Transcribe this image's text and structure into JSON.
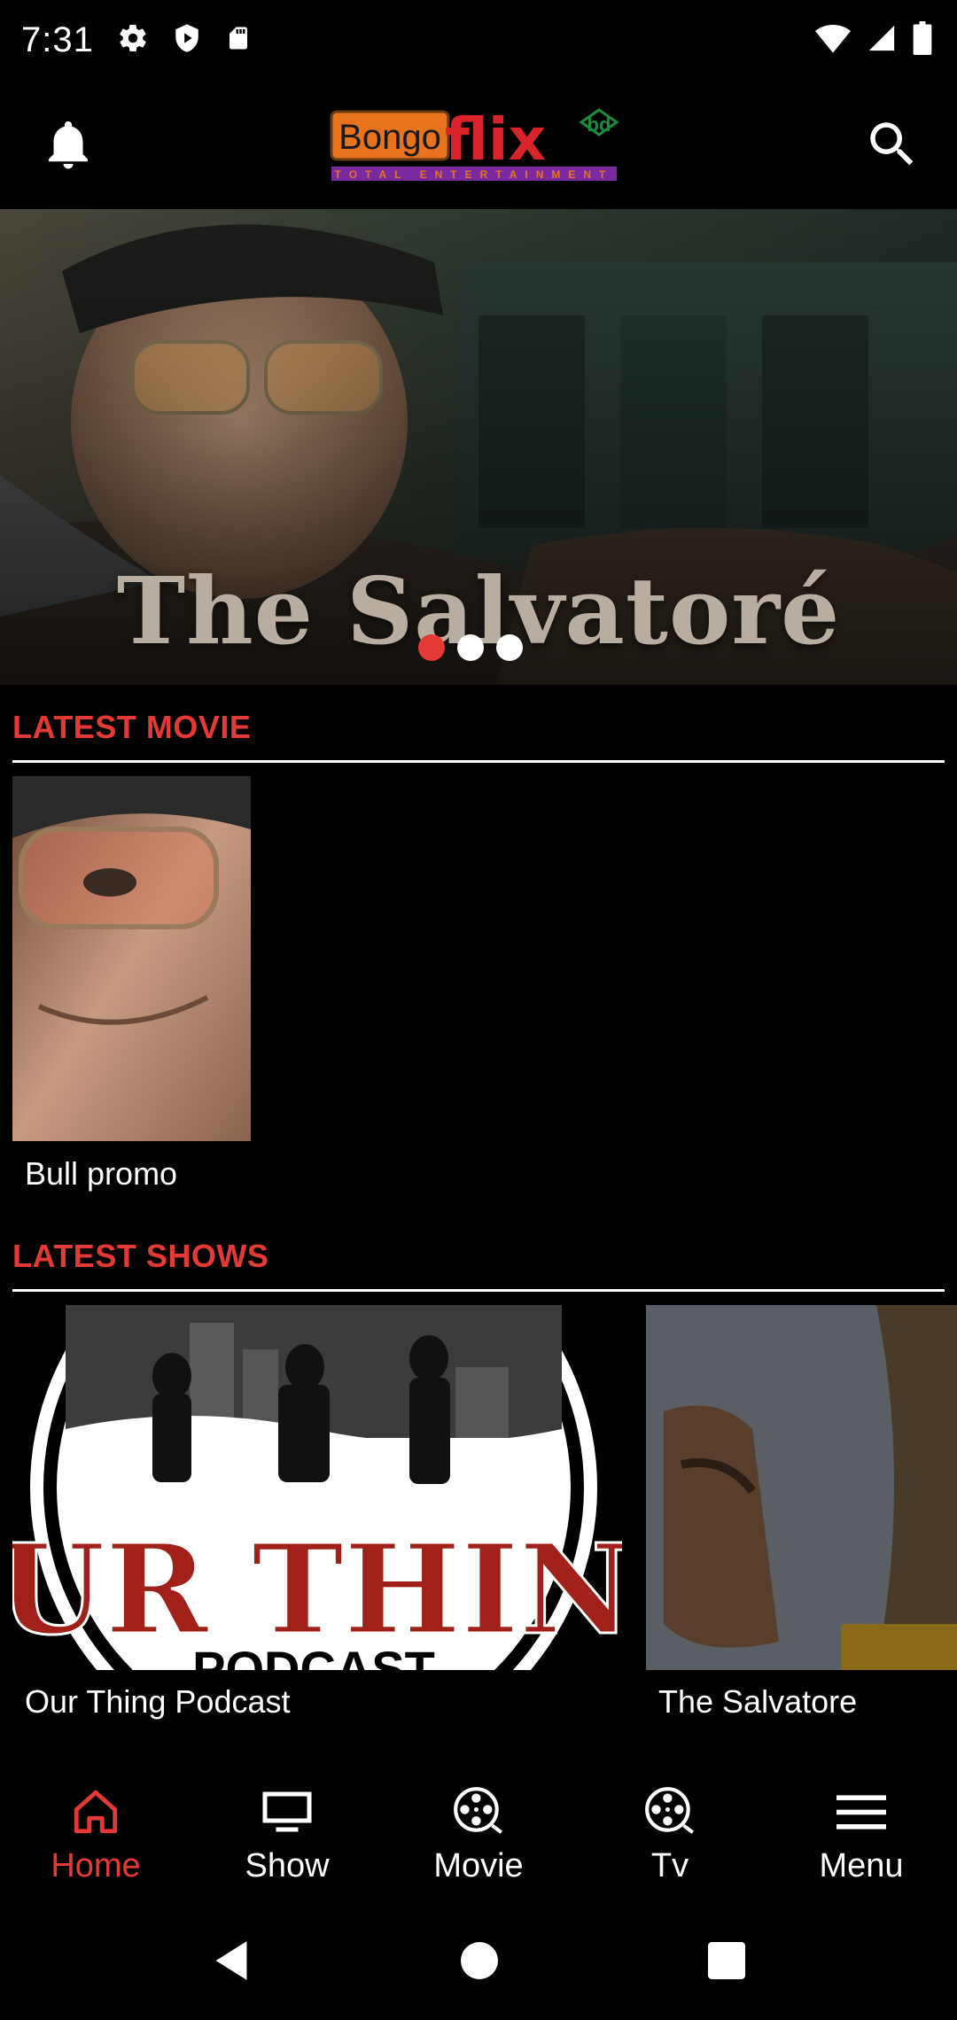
{
  "status_bar": {
    "time": "7:31",
    "icons": [
      "gear-icon",
      "shield-play-icon",
      "sd-card-icon",
      "wifi-icon",
      "signal-icon",
      "battery-icon"
    ]
  },
  "app_bar": {
    "logo_main": "Bongo",
    "logo_flix": "flix",
    "logo_bd": "bd",
    "logo_tagline": "TOTAL ENTERTAINMENT",
    "icons": [
      "bell-icon",
      "search-icon"
    ]
  },
  "hero": {
    "title": "The Salvatoré",
    "slides": 3,
    "active_slide": 1
  },
  "latest_movie": {
    "heading": "LATEST MOVIE",
    "items": [
      {
        "label": "Bull promo"
      }
    ]
  },
  "latest_shows": {
    "heading": "LATEST SHOWS",
    "items": [
      {
        "label": "Our Thing Podcast",
        "poster_title": "OUR THING",
        "poster_sub": "PODCAST"
      },
      {
        "label": "The Salvatore"
      }
    ]
  },
  "bottom_nav": {
    "items": [
      {
        "label": "Home",
        "icon": "home-icon",
        "active": true
      },
      {
        "label": "Show",
        "icon": "monitor-icon",
        "active": false
      },
      {
        "label": "Movie",
        "icon": "film-reel-icon",
        "active": false
      },
      {
        "label": "Tv",
        "icon": "film-reel-icon",
        "active": false
      },
      {
        "label": "Menu",
        "icon": "hamburger-menu-icon",
        "active": false
      }
    ]
  },
  "colors": {
    "accent": "#e53935",
    "background": "#000000",
    "text": "#ffffff"
  }
}
